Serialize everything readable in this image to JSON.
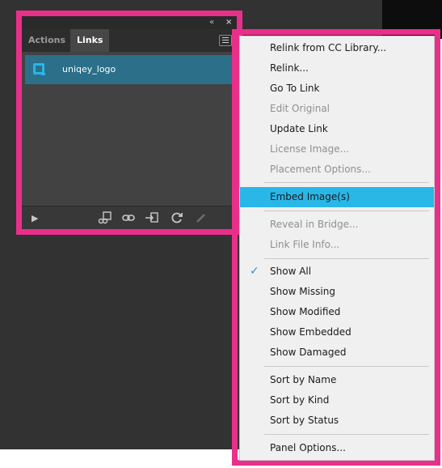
{
  "panel": {
    "collapse_glyph": "«",
    "close_glyph": "×",
    "tabs": [
      {
        "label": "Actions"
      },
      {
        "label": "Links"
      }
    ],
    "links": [
      {
        "name": "uniqey_logo"
      }
    ],
    "footer_icons": [
      "play-icon",
      "relink-from-library-icon",
      "relink-icon",
      "go-to-link-icon",
      "update-link-icon",
      "edit-original-icon"
    ]
  },
  "menu": {
    "items": [
      {
        "label": "Relink from CC Library...",
        "disabled": false
      },
      {
        "label": "Relink...",
        "disabled": false
      },
      {
        "label": "Go To Link",
        "disabled": false
      },
      {
        "label": "Edit Original",
        "disabled": true
      },
      {
        "label": "Update Link",
        "disabled": false
      },
      {
        "label": "License Image...",
        "disabled": true
      },
      {
        "label": "Placement Options...",
        "disabled": true
      },
      {
        "label": "Embed Image(s)",
        "disabled": false,
        "highlighted": true
      },
      {
        "label": "Reveal in Bridge...",
        "disabled": true
      },
      {
        "label": "Link File Info...",
        "disabled": true
      },
      {
        "label": "Show All",
        "checked": true
      },
      {
        "label": "Show Missing"
      },
      {
        "label": "Show Modified"
      },
      {
        "label": "Show Embedded"
      },
      {
        "label": "Show Damaged"
      },
      {
        "label": "Sort by Name"
      },
      {
        "label": "Sort by Kind"
      },
      {
        "label": "Sort by Status"
      },
      {
        "label": "Panel Options..."
      }
    ]
  },
  "colors": {
    "highlight_outline": "#e8308a",
    "menu_highlight": "#29b7e8",
    "selected_row": "#2b6f89",
    "link_icon": "#29b6e9"
  }
}
